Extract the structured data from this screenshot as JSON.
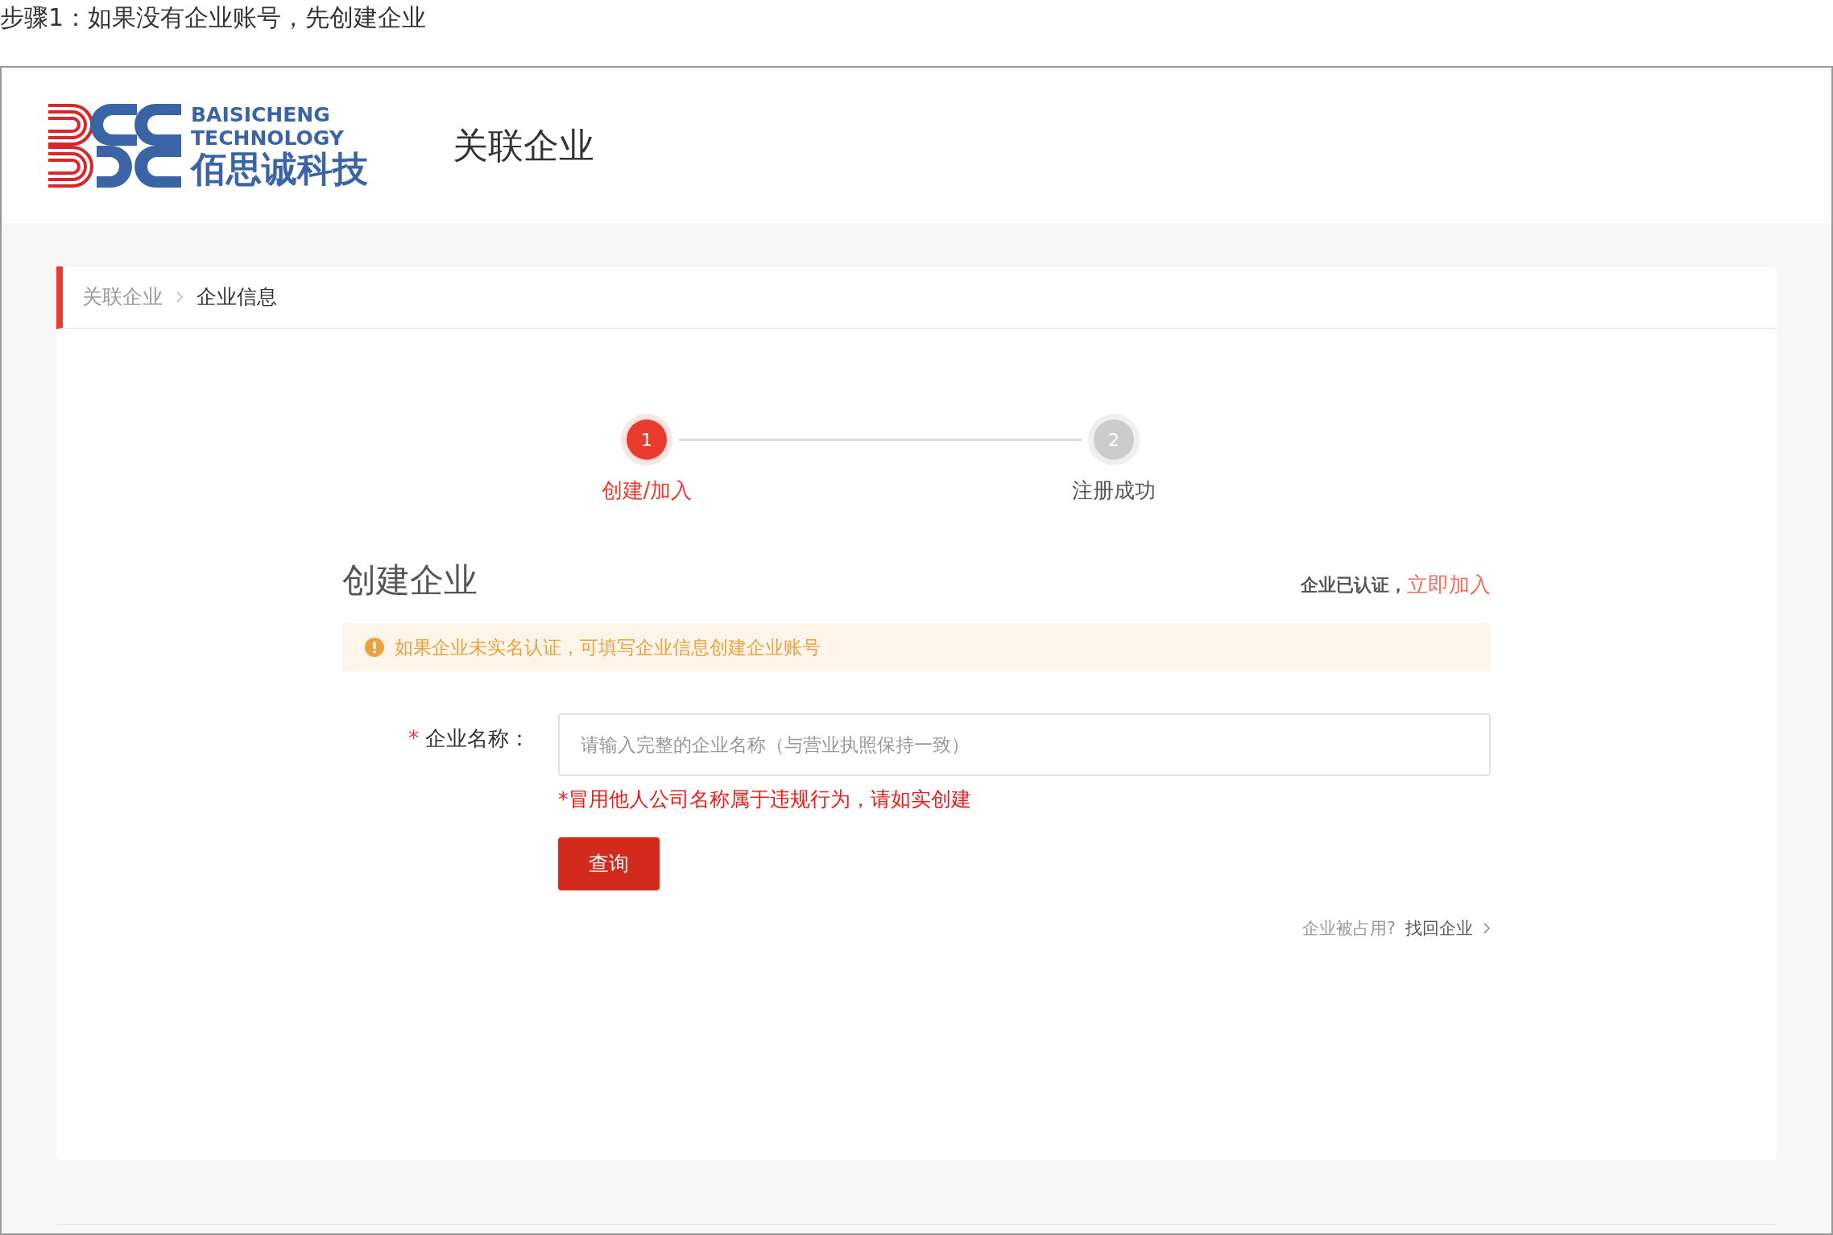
{
  "caption": "步骤1：如果没有企业账号，先创建企业",
  "logo": {
    "line_1": "BAISICHENG",
    "line_2": "TECHNOLOGY",
    "line_3": "佰思诚科技"
  },
  "header": {
    "title": "关联企业"
  },
  "breadcrumb": [
    {
      "label": "关联企业",
      "selected": false
    },
    {
      "label": "企业信息",
      "selected": true
    }
  ],
  "steps": [
    {
      "number": "1",
      "label": "创建/加入",
      "selected": true
    },
    {
      "number": "2",
      "label": "注册成功",
      "selected": false
    }
  ],
  "form": {
    "title": "创建企业",
    "join_hint": "企业已认证，",
    "join_link": "立即加入",
    "alert": "如果企业未实名认证，可填写企业信息创建企业账号",
    "required_mark": "*",
    "field_label": "企业名称：",
    "placeholder": "请输入完整的企业名称（与营业执照保持一致）",
    "warning": "*冒用他人公司名称属于违规行为，请如实创建",
    "button": "查询",
    "footer_question": "企业被占用?",
    "footer_link": "找回企业"
  }
}
